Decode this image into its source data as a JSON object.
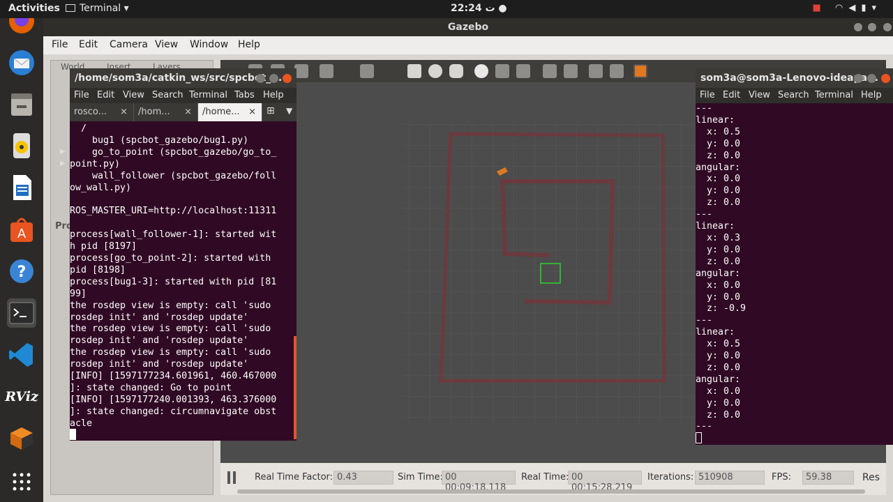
{
  "topbar": {
    "activities": "Activities",
    "app_menu": "Terminal ▾",
    "clock": "22:24 ت ●"
  },
  "dock": {
    "items": [
      "firefox-icon",
      "thunderbird-icon",
      "files-icon",
      "rhythmbox-icon",
      "libreoffice-writer-icon",
      "software-icon",
      "help-icon",
      "terminal-icon",
      "vscode-icon",
      "rviz-icon",
      "gazebo-icon",
      "show-apps-icon"
    ],
    "rviz_label": "RViz"
  },
  "gazebo": {
    "title": "Gazebo",
    "menu": [
      "File",
      "Edit",
      "Camera",
      "View",
      "Window",
      "Help"
    ],
    "left_tabs": [
      "World",
      "Insert",
      "Layers"
    ],
    "left_prop_label": "Pro",
    "bottom": {
      "rtf_label": "Real Time Factor:",
      "rtf_value": "0.43",
      "sim_label": "Sim Time:",
      "sim_value": "00 00:09:18.118",
      "real_label": "Real Time:",
      "real_value": "00 00:15:28.219",
      "iter_label": "Iterations:",
      "iter_value": "510908",
      "fps_label": "FPS:",
      "fps_value": "59.38",
      "reset_label": "Res"
    }
  },
  "terminal_left": {
    "title": "/home/som3a/catkin_ws/src/spcbot_...",
    "menu": [
      "File",
      "Edit",
      "View",
      "Search",
      "Terminal",
      "Tabs",
      "Help"
    ],
    "tabs": [
      "rosco...",
      "/hom...",
      "/home..."
    ],
    "output": "  /\n    bug1 (spcbot_gazebo/bug1.py)\n    go_to_point (spcbot_gazebo/go_to_\npoint.py)\n    wall_follower (spcbot_gazebo/foll\now_wall.py)\n\nROS_MASTER_URI=http://localhost:11311\n\nprocess[wall_follower-1]: started wit\nh pid [8197]\nprocess[go_to_point-2]: started with\npid [8198]\nprocess[bug1-3]: started with pid [81\n99]\nthe rosdep view is empty: call 'sudo\nrosdep init' and 'rosdep update'\nthe rosdep view is empty: call 'sudo\nrosdep init' and 'rosdep update'\nthe rosdep view is empty: call 'sudo\nrosdep init' and 'rosdep update'\n[INFO] [1597177234.601961, 460.467000\n]: state changed: Go to point\n[INFO] [1597177240.001393, 463.376000\n]: state changed: circumnavigate obst\nacle"
  },
  "terminal_right": {
    "title": "som3a@som3a-Lenovo-ideapa...",
    "menu": [
      "File",
      "Edit",
      "View",
      "Search",
      "Terminal",
      "Help"
    ],
    "output": "---\nlinear:\n  x: 0.5\n  y: 0.0\n  z: 0.0\nangular:\n  x: 0.0\n  y: 0.0\n  z: 0.0\n---\nlinear:\n  x: 0.3\n  y: 0.0\n  z: 0.0\nangular:\n  x: 0.0\n  y: 0.0\n  z: -0.9\n---\nlinear:\n  x: 0.5\n  y: 0.0\n  z: 0.0\nangular:\n  x: 0.0\n  y: 0.0\n  z: 0.0\n---"
  },
  "colors": {
    "terminal_bg": "#300a24",
    "wall": "#6b3a3e",
    "goal": "#2fd12f",
    "robot": "#e07822"
  }
}
